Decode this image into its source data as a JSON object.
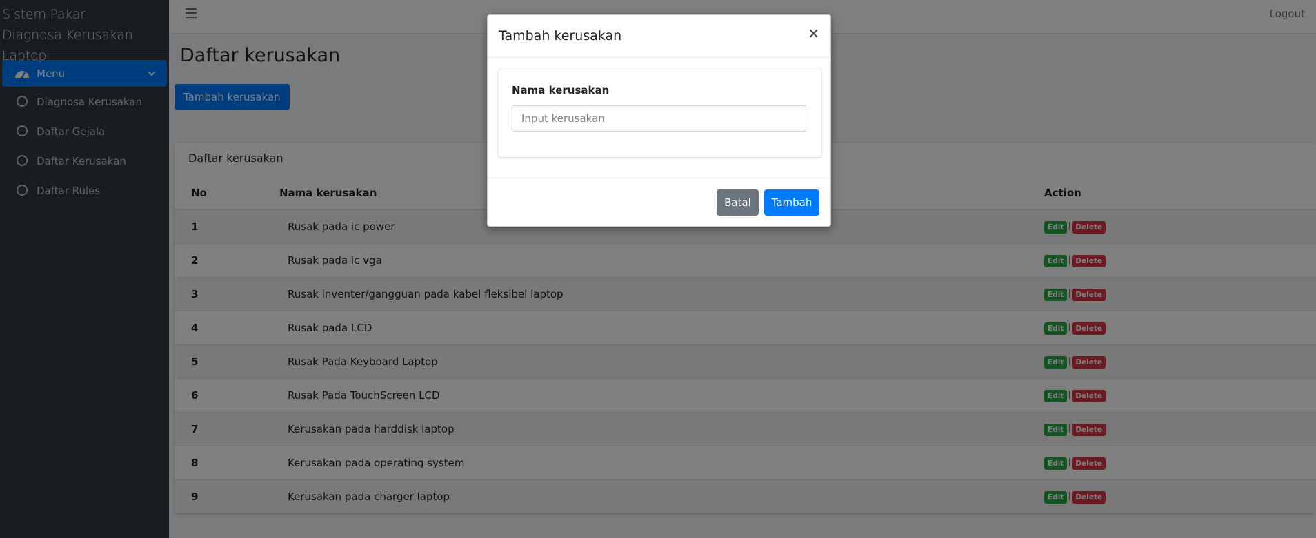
{
  "brand": {
    "line1": "Sistem Pakar",
    "line2": "Diagnosa Kerusakan Laptop"
  },
  "sidebar": {
    "menu_label": "Menu",
    "items": [
      {
        "label": "Diagnosa Kerusakan"
      },
      {
        "label": "Daftar Gejala"
      },
      {
        "label": "Daftar Kerusakan"
      },
      {
        "label": "Daftar Rules"
      }
    ]
  },
  "topbar": {
    "logout": "Logout"
  },
  "page": {
    "title": "Daftar kerusakan",
    "add_button": "Tambah kerusakan"
  },
  "table": {
    "card_title": "Daftar kerusakan",
    "headers": {
      "no": "No",
      "name": "Nama kerusakan",
      "action": "Action"
    },
    "edit_label": "Edit",
    "delete_label": "Delete",
    "rows": [
      {
        "no": "1",
        "name": "Rusak pada ic power"
      },
      {
        "no": "2",
        "name": "Rusak pada ic vga"
      },
      {
        "no": "3",
        "name": "Rusak inventer/gangguan pada kabel fleksibel laptop"
      },
      {
        "no": "4",
        "name": "Rusak pada LCD"
      },
      {
        "no": "5",
        "name": "Rusak Pada Keyboard Laptop"
      },
      {
        "no": "6",
        "name": "Rusak Pada TouchScreen LCD"
      },
      {
        "no": "7",
        "name": "Kerusakan pada harddisk laptop"
      },
      {
        "no": "8",
        "name": "Kerusakan pada operating system"
      },
      {
        "no": "9",
        "name": "Kerusakan pada charger laptop"
      }
    ]
  },
  "modal": {
    "title": "Tambah kerusakan",
    "close": "×",
    "field_label": "Nama kerusakan",
    "field_placeholder": "Input kerusakan",
    "field_value": "",
    "cancel": "Batal",
    "submit": "Tambah"
  },
  "colors": {
    "primary": "#007bff",
    "sidebar_bg": "#343a40",
    "edit_badge": "#28a745",
    "delete_badge": "#dc3545",
    "secondary": "#6c757d"
  },
  "icons": {
    "menu": "tachometer-icon",
    "menu_chevron": "chevron-down-icon",
    "nav_item": "circle-icon",
    "hamburger": "hamburger-icon",
    "close": "close-icon"
  }
}
